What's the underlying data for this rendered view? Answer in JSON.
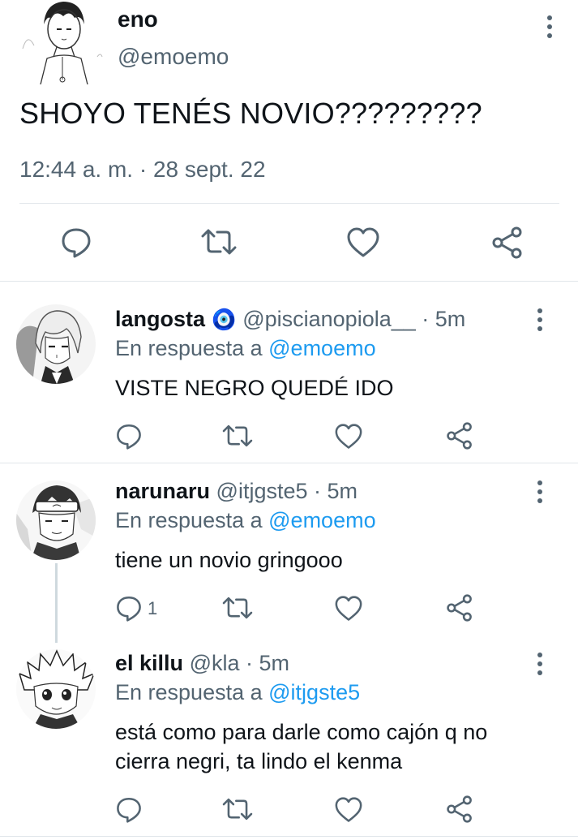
{
  "main_tweet": {
    "name": "eno",
    "handle": "@emoemo",
    "text": "SHOYO TENÉS NOVIO?????????",
    "timestamp": "12:44 a. m. · 28 sept. 22"
  },
  "replies": [
    {
      "name": "langosta",
      "emoji": "🧿",
      "handle": "@piscianopiola__",
      "time": "· 5m",
      "reply_prefix": "En respuesta a",
      "reply_to": "@emoemo",
      "text": "VISTE NEGRO QUEDÉ IDO",
      "reply_count": ""
    },
    {
      "name": "narunaru",
      "handle": "@itjgste5",
      "time": "· 5m",
      "reply_prefix": "En respuesta a",
      "reply_to": "@emoemo",
      "text": "tiene un novio gringooo",
      "reply_count": "1"
    },
    {
      "name": "el killu",
      "handle": "@kla",
      "time": "· 5m",
      "reply_prefix": "En respuesta a",
      "reply_to": "@itjgste5",
      "text_line1": "está como para darle como cajón q no",
      "text_line2": "cierra negri, ta lindo el kenma",
      "reply_count": ""
    }
  ],
  "colors": {
    "text": "#0f1419",
    "muted": "#536471",
    "link": "#1d9bf0",
    "divider": "#e1e6ea"
  },
  "icons": [
    "more-icon",
    "reply-icon",
    "retweet-icon",
    "like-icon",
    "share-icon"
  ]
}
